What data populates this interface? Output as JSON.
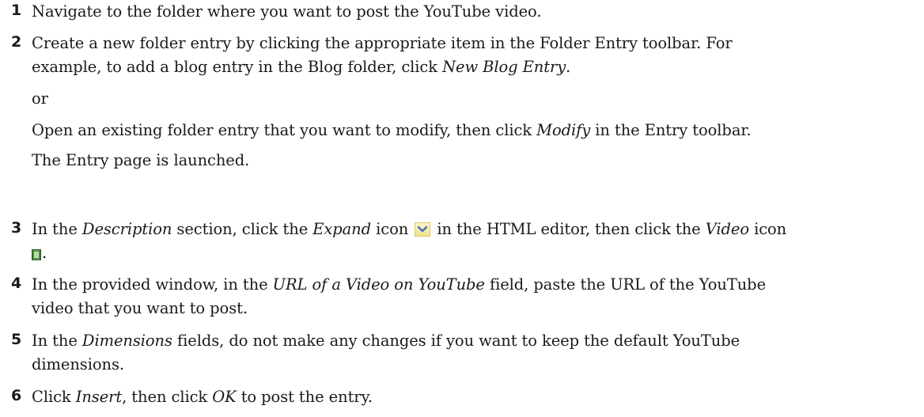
{
  "steps": [
    {
      "num": "1",
      "text": "Navigate to the folder where you want to post the YouTube video."
    },
    {
      "num": "2",
      "line1": "Create a new folder entry by clicking the appropriate item in the Folder Entry toolbar. For",
      "line2_a": "example, to add a blog entry in the Blog folder, click ",
      "line2_em": "New Blog Entry",
      "line2_b": ".",
      "or": "or",
      "alt_a": "Open an existing folder entry that you want to modify, then click ",
      "alt_em": "Modify",
      "alt_b": " in the Entry toolbar.",
      "result": "The Entry page is launched."
    },
    {
      "num": "3",
      "a": "In the ",
      "em1": "Description",
      "b": " section, click the ",
      "em2": "Expand",
      "c": " icon ",
      "d": " in the HTML editor, then click the ",
      "em3": "Video",
      "e": " icon",
      "f": ".",
      "icons": [
        "expand-icon",
        "video-icon"
      ]
    },
    {
      "num": "4",
      "a": "In the provided window, in the ",
      "em": "URL of a Video on YouTube",
      "b": " field, paste the URL of the YouTube",
      "line2": "video that you want to post."
    },
    {
      "num": "5",
      "a": "In the ",
      "em": "Dimensions",
      "b": " fields, do not make any changes if you want to keep the default YouTube",
      "line2": "dimensions."
    },
    {
      "num": "6",
      "a": "Click ",
      "em1": "Insert",
      "b": ", then click ",
      "em2": "OK",
      "c": " to post the entry."
    }
  ]
}
